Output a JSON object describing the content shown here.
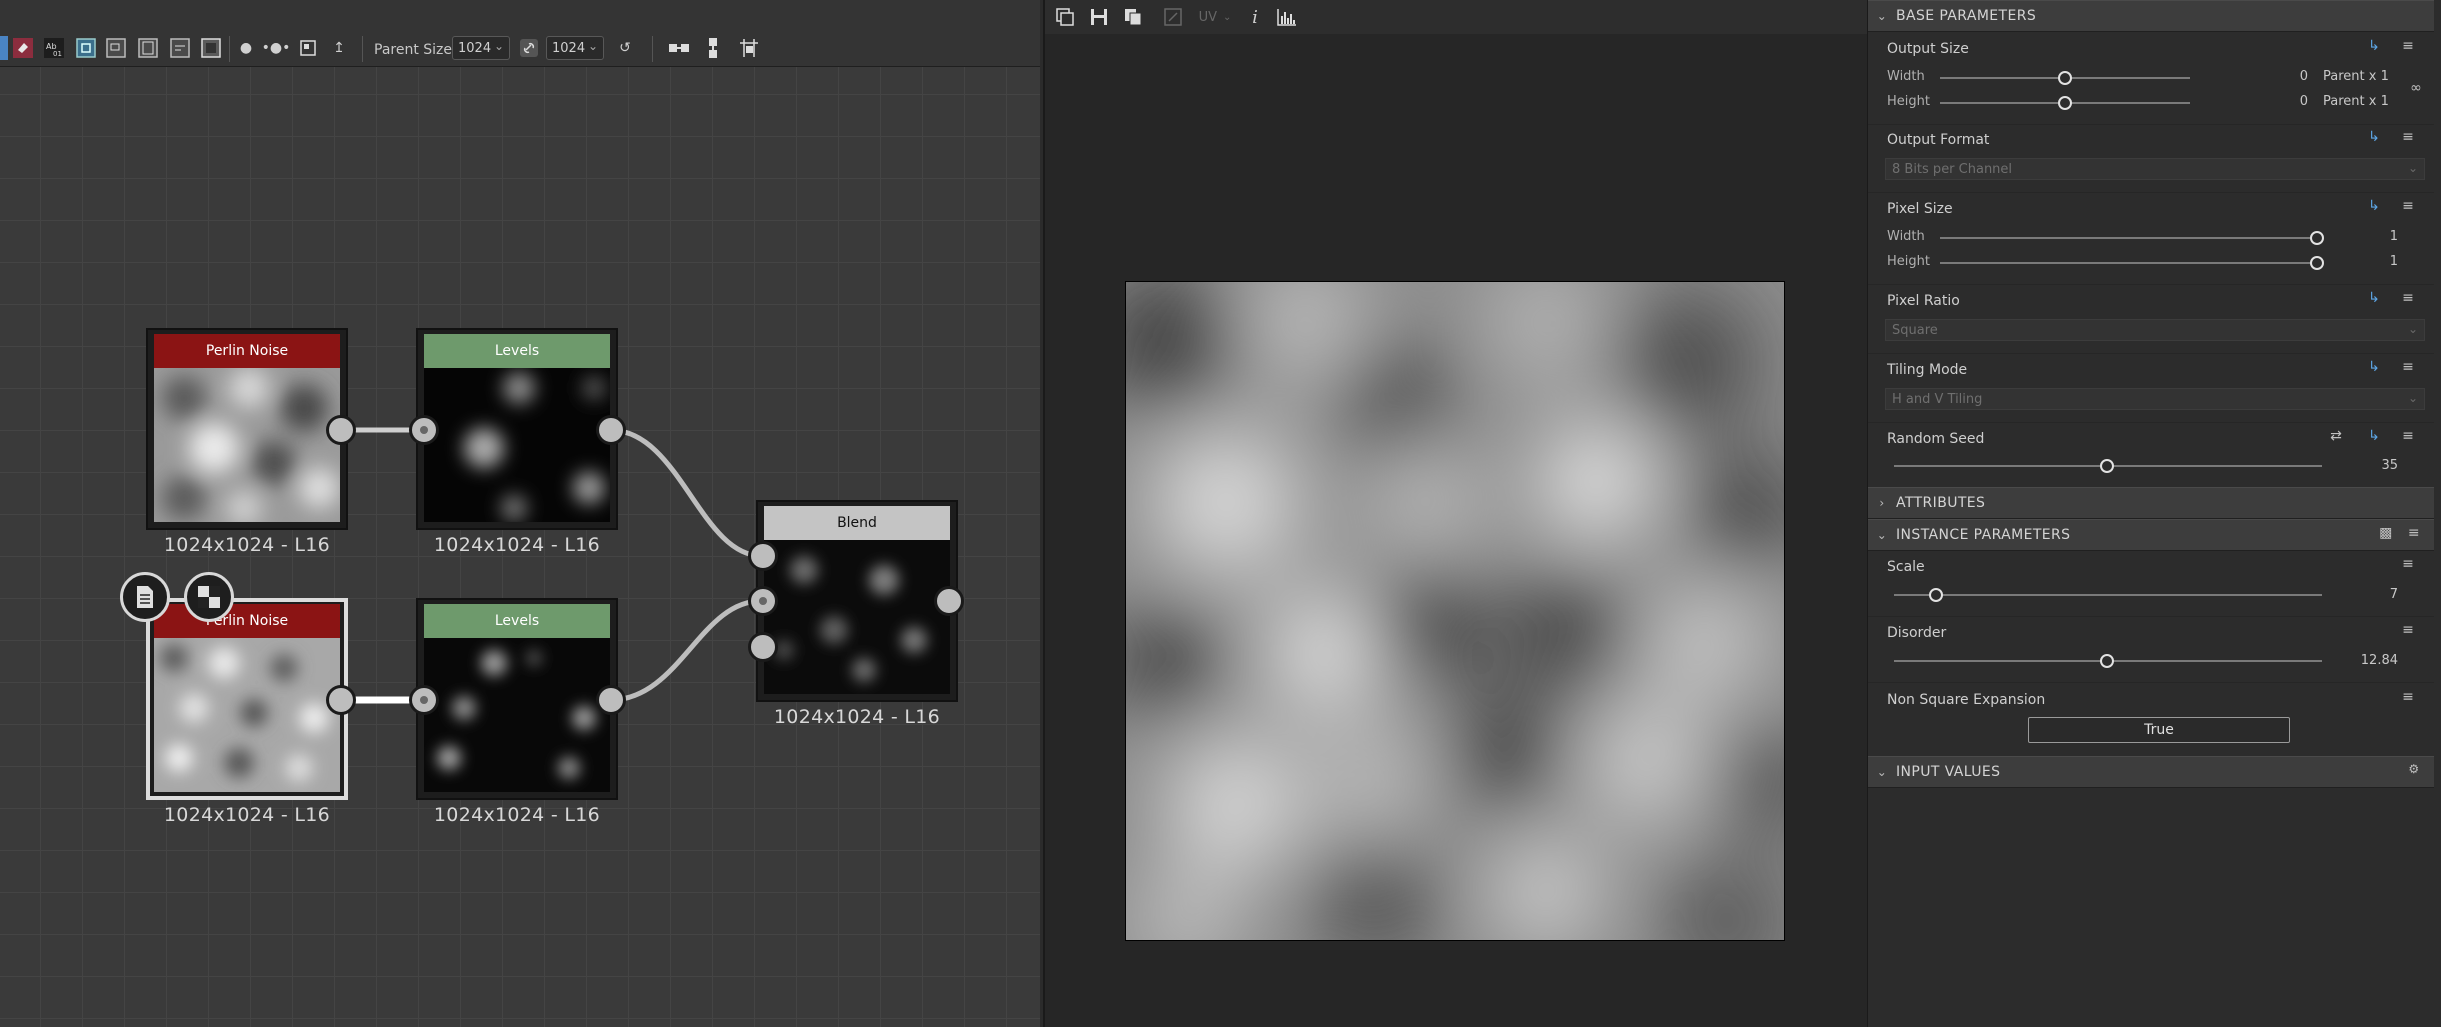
{
  "graph_toolbar": {
    "parent_size_label": "Parent Size:",
    "width_value": "1024",
    "height_value": "1024"
  },
  "nodes": [
    {
      "title": "Perlin Noise",
      "caption": "1024x1024 - L16",
      "color": "#8b1414"
    },
    {
      "title": "Levels",
      "caption": "1024x1024 - L16",
      "color": "#6e9a6c"
    },
    {
      "title": "Blend",
      "caption": "1024x1024 - L16",
      "color": "#c4c4c4"
    },
    {
      "title": "Perlin Noise",
      "caption": "1024x1024 - L16",
      "color": "#8b1414"
    },
    {
      "title": "Levels",
      "caption": "1024x1024 - L16",
      "color": "#6e9a6c"
    }
  ],
  "preview_toolbar": {
    "uv_label": "UV",
    "info_label": "i"
  },
  "properties": {
    "base_header": "BASE PARAMETERS",
    "output_size": {
      "label": "Output Size",
      "width_label": "Width",
      "height_label": "Height",
      "width_value": "0",
      "height_value": "0",
      "width_mode": "Parent x 1",
      "height_mode": "Parent x 1"
    },
    "output_format": {
      "label": "Output Format",
      "value": "8 Bits per Channel"
    },
    "pixel_size": {
      "label": "Pixel Size",
      "width_label": "Width",
      "height_label": "Height",
      "width_value": "1",
      "height_value": "1"
    },
    "pixel_ratio": {
      "label": "Pixel Ratio",
      "value": "Square"
    },
    "tiling_mode": {
      "label": "Tiling Mode",
      "value": "H and V Tiling"
    },
    "random_seed": {
      "label": "Random Seed",
      "value": "35",
      "level": 0.5
    },
    "attributes_header": "ATTRIBUTES",
    "instance_header": "INSTANCE PARAMETERS",
    "scale": {
      "label": "Scale",
      "value": "7",
      "level": 0.09
    },
    "disorder": {
      "label": "Disorder",
      "value": "12.84",
      "level": 0.5
    },
    "non_square": {
      "label": "Non Square Expansion",
      "value": "True"
    },
    "input_values_header": "INPUT VALUES"
  },
  "colors": {
    "accent_blue": "#5da6e6",
    "perlin_header": "#8b1414",
    "levels_header": "#6e9a6c",
    "blend_header": "#c4c4c4"
  }
}
